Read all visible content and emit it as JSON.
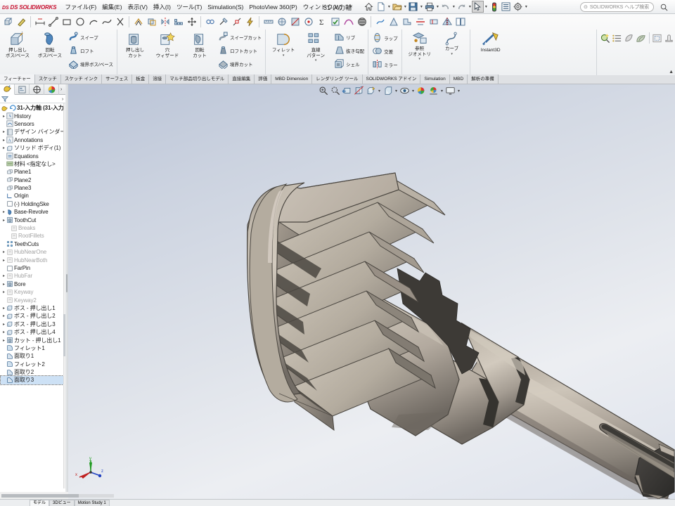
{
  "app": {
    "brand": "DS SOLIDWORKS",
    "document_title": "31-入力軸",
    "help_placeholder": "SOLIDWORKS ヘルプ検索"
  },
  "menu": {
    "items": [
      {
        "label": "ファイル(F)"
      },
      {
        "label": "編集(E)"
      },
      {
        "label": "表示(V)"
      },
      {
        "label": "挿入(I)"
      },
      {
        "label": "ツール(T)"
      },
      {
        "label": "Simulation(S)"
      },
      {
        "label": "PhotoView 360(P)"
      },
      {
        "label": "ウィンドウ(W)"
      }
    ],
    "pin": "✶"
  },
  "quick_access": [
    {
      "name": "home-icon",
      "label": "ホーム"
    },
    {
      "name": "new-document-icon",
      "label": "新規"
    },
    {
      "name": "open-document-icon",
      "label": "開く"
    },
    {
      "name": "save-icon",
      "label": "保存"
    },
    {
      "name": "print-icon",
      "label": "印刷"
    },
    {
      "name": "undo-icon",
      "label": "元に戻す"
    },
    {
      "name": "redo-icon",
      "label": "やり直し"
    },
    {
      "name": "select-arrow-icon",
      "label": "選択"
    },
    {
      "name": "rebuild-icon",
      "label": "再構築"
    },
    {
      "name": "options-list-icon",
      "label": "オプション一覧"
    },
    {
      "name": "gear-settings-icon",
      "label": "オプション"
    }
  ],
  "ribbon": {
    "row1": [
      {
        "name": "sketch-icon"
      },
      {
        "name": "smart-dimension-icon"
      },
      {
        "name": "line-icon"
      },
      {
        "name": "rectangle-icon"
      },
      {
        "name": "circle-icon"
      },
      {
        "name": "arc-icon"
      },
      {
        "name": "spline-icon"
      },
      {
        "name": "trim-icon"
      },
      {
        "name": "offset-icon"
      },
      {
        "name": "convert-entities-icon"
      },
      {
        "name": "mirror-icon"
      },
      {
        "name": "linear-pattern-icon"
      },
      {
        "name": "move-entities-icon"
      },
      {
        "name": "display-delete-relation-icon"
      },
      {
        "name": "repair-sketch-icon"
      },
      {
        "name": "quick-snaps-icon"
      },
      {
        "name": "rapid-sketch-icon"
      },
      {
        "name": "measure-icon"
      },
      {
        "name": "mass-properties-icon"
      },
      {
        "name": "section-properties-icon"
      },
      {
        "name": "sensor-icon"
      },
      {
        "name": "check-icon"
      },
      {
        "name": "geometry-analysis-icon"
      },
      {
        "name": "curvature-icon"
      },
      {
        "name": "zebra-stripes-icon"
      },
      {
        "name": "deviation-analysis-icon"
      },
      {
        "name": "draft-analysis-icon"
      },
      {
        "name": "undercut-detection-icon"
      },
      {
        "name": "parting-line-icon"
      },
      {
        "name": "thickness-analysis-icon"
      },
      {
        "name": "symmetry-check-icon"
      },
      {
        "name": "compare-documents-icon"
      }
    ],
    "groups": [
      {
        "name": "boss-base-group",
        "big": [
          {
            "label": "押し出し\nボス/ベース",
            "icon": "extrude-boss-icon"
          },
          {
            "label": "回転\nボス/ベース",
            "icon": "revolve-boss-icon"
          }
        ],
        "small": [
          {
            "label": "スイープ",
            "icon": "sweep-icon"
          },
          {
            "label": "ロフト",
            "icon": "loft-icon"
          },
          {
            "label": "境界ボス/ベース",
            "icon": "boundary-boss-icon"
          }
        ]
      },
      {
        "name": "cut-group",
        "big": [
          {
            "label": "押し出し\nカット",
            "icon": "extrude-cut-icon"
          },
          {
            "label": "穴\nウィザード",
            "icon": "hole-wizard-icon"
          },
          {
            "label": "回転\nカット",
            "icon": "revolve-cut-icon"
          }
        ],
        "small": [
          {
            "label": "スイープカット",
            "icon": "sweep-cut-icon"
          },
          {
            "label": "ロフトカット",
            "icon": "loft-cut-icon"
          },
          {
            "label": "境界カット",
            "icon": "boundary-cut-icon"
          }
        ]
      },
      {
        "name": "feature-group",
        "big": [
          {
            "label": "フィレット",
            "icon": "fillet-icon"
          },
          {
            "label": "直線\nパターン",
            "icon": "linear-pattern-big-icon"
          }
        ],
        "small": [
          {
            "label": "リブ",
            "icon": "rib-icon"
          },
          {
            "label": "抜き勾配",
            "icon": "draft-icon"
          },
          {
            "label": "シェル",
            "icon": "shell-icon"
          }
        ]
      },
      {
        "name": "wrap-group",
        "big": [],
        "small": [
          {
            "label": "ラップ",
            "icon": "wrap-icon"
          },
          {
            "label": "交差",
            "icon": "intersect-icon"
          },
          {
            "label": "ミラー",
            "icon": "mirror-feature-icon"
          }
        ]
      },
      {
        "name": "reference-group",
        "big": [
          {
            "label": "参照\nジオメトリ",
            "icon": "reference-geometry-icon"
          },
          {
            "label": "カーブ",
            "icon": "curves-icon"
          }
        ],
        "small": []
      },
      {
        "name": "instant3d-group",
        "big": [
          {
            "label": "Instant3D",
            "icon": "instant3d-icon"
          }
        ],
        "small": []
      }
    ],
    "right_icons": [
      {
        "name": "display-manager-search-icon"
      },
      {
        "name": "appearances-list-icon"
      },
      {
        "name": "scene-icon"
      },
      {
        "name": "decal-icon"
      },
      {
        "name": "render-region-icon"
      },
      {
        "name": "render-tools-icon"
      }
    ],
    "collapse": "▲"
  },
  "tabs": [
    {
      "label": "フィーチャー",
      "active": true
    },
    {
      "label": "スケッチ",
      "active": false
    },
    {
      "label": "スケッチ インク",
      "active": false
    },
    {
      "label": "サーフェス",
      "active": false
    },
    {
      "label": "板金",
      "active": false
    },
    {
      "label": "溶接",
      "active": false
    },
    {
      "label": "マルチ部品切り出しモデル",
      "active": false
    },
    {
      "label": "直接編集",
      "active": false
    },
    {
      "label": "評価",
      "active": false
    },
    {
      "label": "MBD Dimension",
      "active": false
    },
    {
      "label": "レンダリング ツール",
      "active": false
    },
    {
      "label": "SOLIDWORKS アドイン",
      "active": false
    },
    {
      "label": "Simulation",
      "active": false
    },
    {
      "label": "MBD",
      "active": false
    },
    {
      "label": "解析の準備",
      "active": false
    }
  ],
  "feature_manager": {
    "tabs": [
      {
        "name": "feature-manager-tab",
        "active": true
      },
      {
        "name": "property-manager-tab",
        "active": false
      },
      {
        "name": "configuration-manager-tab",
        "active": false
      },
      {
        "name": "display-manager-tab",
        "active": false
      }
    ],
    "filter_placeholder": "",
    "root": "31-入力軸 (31-入力",
    "nodes": [
      {
        "label": "History",
        "expand": true,
        "icon": "history-icon",
        "dim": false,
        "indent": 0
      },
      {
        "label": "Sensors",
        "expand": false,
        "icon": "sensors-icon",
        "dim": false,
        "indent": 0
      },
      {
        "label": "デザイン バインダー",
        "expand": true,
        "icon": "binder-icon",
        "dim": false,
        "indent": 0
      },
      {
        "label": "Annotations",
        "expand": true,
        "icon": "annotations-icon",
        "dim": false,
        "indent": 0
      },
      {
        "label": "ソリッド ボディ(1)",
        "expand": true,
        "icon": "solid-bodies-icon",
        "dim": false,
        "indent": 0
      },
      {
        "label": "Equations",
        "expand": false,
        "icon": "equations-icon",
        "dim": false,
        "indent": 0
      },
      {
        "label": "材料 <指定なし>",
        "expand": false,
        "icon": "material-icon",
        "dim": false,
        "indent": 0
      },
      {
        "label": "Plane1",
        "expand": false,
        "icon": "plane-icon",
        "dim": false,
        "indent": 0
      },
      {
        "label": "Plane2",
        "expand": false,
        "icon": "plane-icon",
        "dim": false,
        "indent": 0
      },
      {
        "label": "Plane3",
        "expand": false,
        "icon": "plane-icon",
        "dim": false,
        "indent": 0
      },
      {
        "label": "Origin",
        "expand": false,
        "icon": "origin-icon",
        "dim": false,
        "indent": 0
      },
      {
        "label": "(-) HoldingSke",
        "expand": false,
        "icon": "sketch-node-icon",
        "dim": false,
        "indent": 0
      },
      {
        "label": "Base-Revolve",
        "expand": true,
        "icon": "revolve-node-icon",
        "dim": false,
        "indent": 0
      },
      {
        "label": "ToothCut",
        "expand": true,
        "icon": "cut-node-icon",
        "dim": false,
        "indent": 0
      },
      {
        "label": "Breaks",
        "expand": false,
        "icon": "suppressed-icon",
        "dim": true,
        "indent": 1
      },
      {
        "label": "RootFillets",
        "expand": false,
        "icon": "suppressed-icon",
        "dim": true,
        "indent": 1
      },
      {
        "label": "TeethCuts",
        "expand": false,
        "icon": "pattern-node-icon",
        "dim": false,
        "indent": 0
      },
      {
        "label": "HubNearOne",
        "expand": true,
        "icon": "suppressed-icon",
        "dim": true,
        "indent": 0
      },
      {
        "label": "HubNearBoth",
        "expand": true,
        "icon": "suppressed-icon",
        "dim": true,
        "indent": 0
      },
      {
        "label": "FarPin",
        "expand": false,
        "icon": "sketch-node-icon",
        "dim": false,
        "indent": 0
      },
      {
        "label": "HubFar",
        "expand": true,
        "icon": "suppressed-icon",
        "dim": true,
        "indent": 0
      },
      {
        "label": "Bore",
        "expand": true,
        "icon": "cut-node-icon",
        "dim": false,
        "indent": 0
      },
      {
        "label": "Keyway",
        "expand": true,
        "icon": "suppressed-icon",
        "dim": true,
        "indent": 0
      },
      {
        "label": "Keyway2",
        "expand": false,
        "icon": "suppressed-icon",
        "dim": true,
        "indent": 0
      },
      {
        "label": "ボス - 押し出し1",
        "expand": true,
        "icon": "extrude-node-icon",
        "dim": false,
        "indent": 0
      },
      {
        "label": "ボス - 押し出し2",
        "expand": true,
        "icon": "extrude-node-icon",
        "dim": false,
        "indent": 0
      },
      {
        "label": "ボス - 押し出し3",
        "expand": true,
        "icon": "extrude-node-icon",
        "dim": false,
        "indent": 0
      },
      {
        "label": "ボス - 押し出し4",
        "expand": true,
        "icon": "extrude-node-icon",
        "dim": false,
        "indent": 0
      },
      {
        "label": "カット - 押し出し1",
        "expand": true,
        "icon": "cut-node-icon",
        "dim": false,
        "indent": 0
      },
      {
        "label": "フィレット1",
        "expand": false,
        "icon": "fillet-node-icon",
        "dim": false,
        "indent": 0
      },
      {
        "label": "面取り1",
        "expand": false,
        "icon": "chamfer-node-icon",
        "dim": false,
        "indent": 0
      },
      {
        "label": "フィレット2",
        "expand": false,
        "icon": "fillet-node-icon",
        "dim": false,
        "indent": 0
      },
      {
        "label": "面取り2",
        "expand": false,
        "icon": "chamfer-node-icon",
        "dim": false,
        "indent": 0
      },
      {
        "label": "面取り3",
        "expand": false,
        "icon": "chamfer-node-icon",
        "dim": false,
        "indent": 0,
        "selected": true
      }
    ]
  },
  "view_toolbar": [
    {
      "name": "zoom-to-fit-icon"
    },
    {
      "name": "zoom-to-area-icon"
    },
    {
      "name": "previous-view-icon"
    },
    {
      "name": "section-view-icon"
    },
    {
      "name": "view-orientation-icon"
    },
    {
      "name": "display-style-icon"
    },
    {
      "name": "hide-show-items-icon"
    },
    {
      "name": "edit-appearance-icon"
    },
    {
      "name": "apply-scene-icon"
    },
    {
      "name": "view-settings-icon"
    }
  ],
  "triad": {
    "x_label": "x",
    "y_label": "y",
    "z_label": "z"
  },
  "status_bar": {
    "tabs": [
      {
        "label": "モデル",
        "active": true
      },
      {
        "label": "3Dビュー",
        "active": false
      },
      {
        "label": "Motion Study 1",
        "active": false
      }
    ]
  },
  "colors": {
    "brand_red": "#c8102e",
    "model_body": "#a49b8f",
    "model_highlight": "#cfc8bd",
    "model_shadow": "#3c3a36",
    "viewport_top": "#b9c3d6",
    "viewport_bottom": "#eceef2",
    "selection_blue": "#cde1f5"
  }
}
